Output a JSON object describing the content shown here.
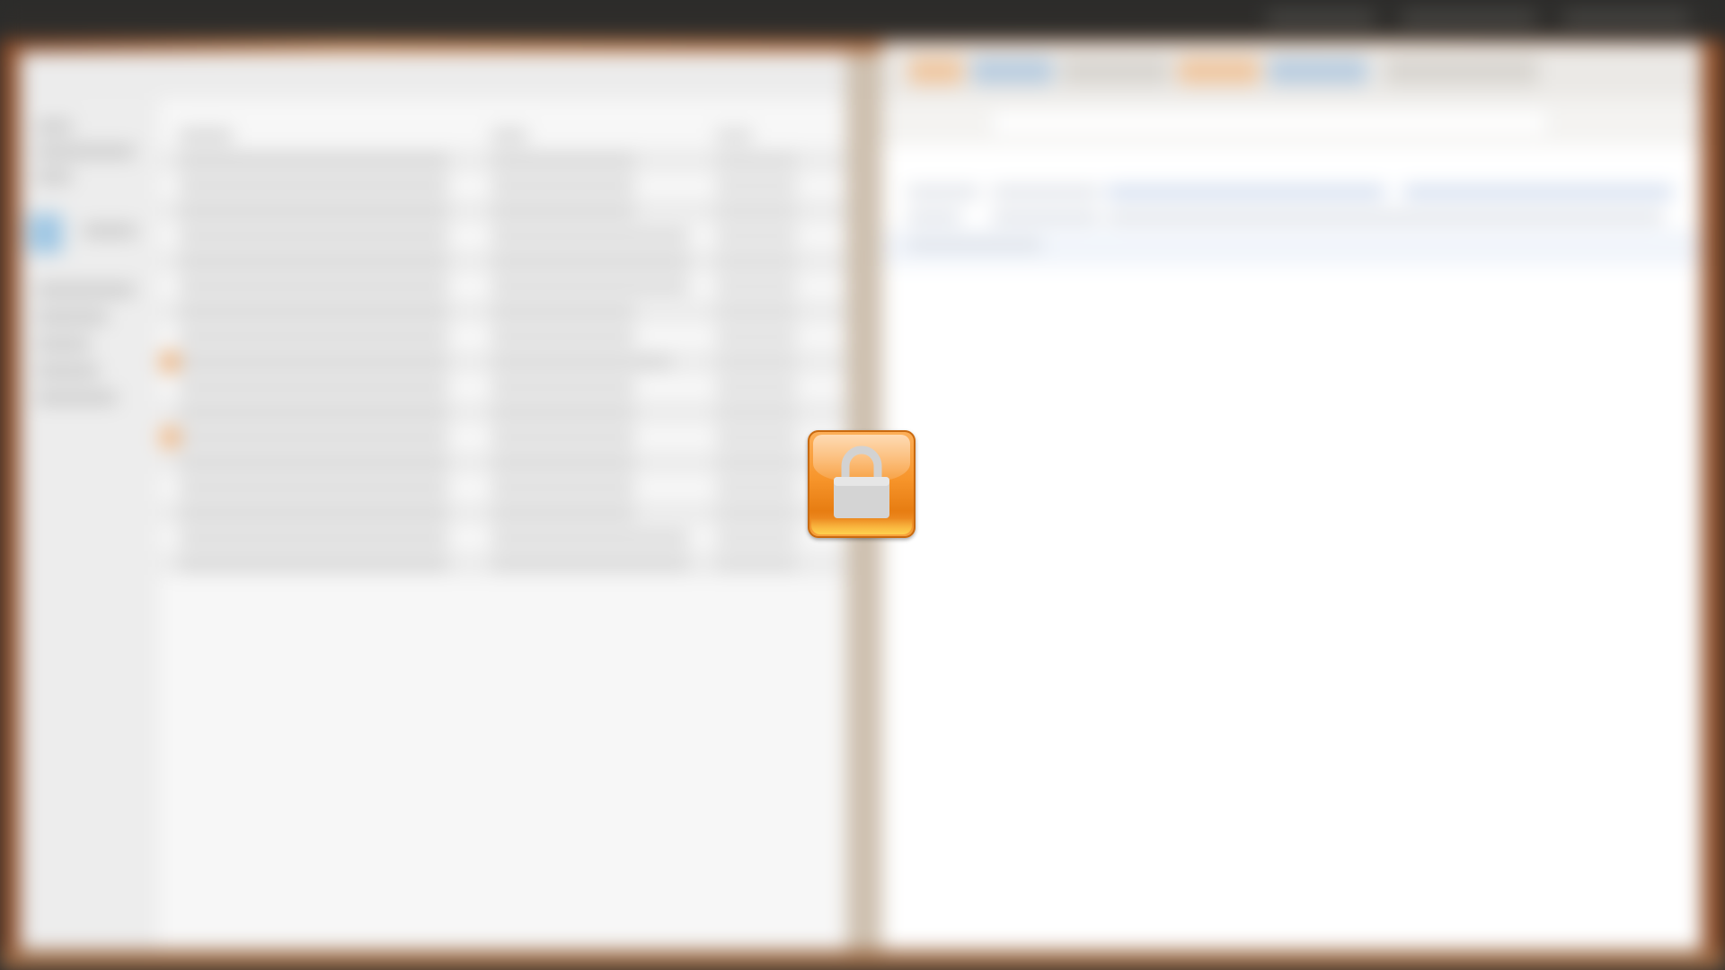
{
  "screen": {
    "state": "locked",
    "lock_icon": "padlock-icon",
    "background_blurred": true
  },
  "colors": {
    "lock_orange": "#f7952b",
    "lock_dark_orange": "#e77d12",
    "padlock_gray": "#cfcfcf",
    "topbar": "#2e2d2b",
    "wallpaper": "#b06a3c"
  }
}
